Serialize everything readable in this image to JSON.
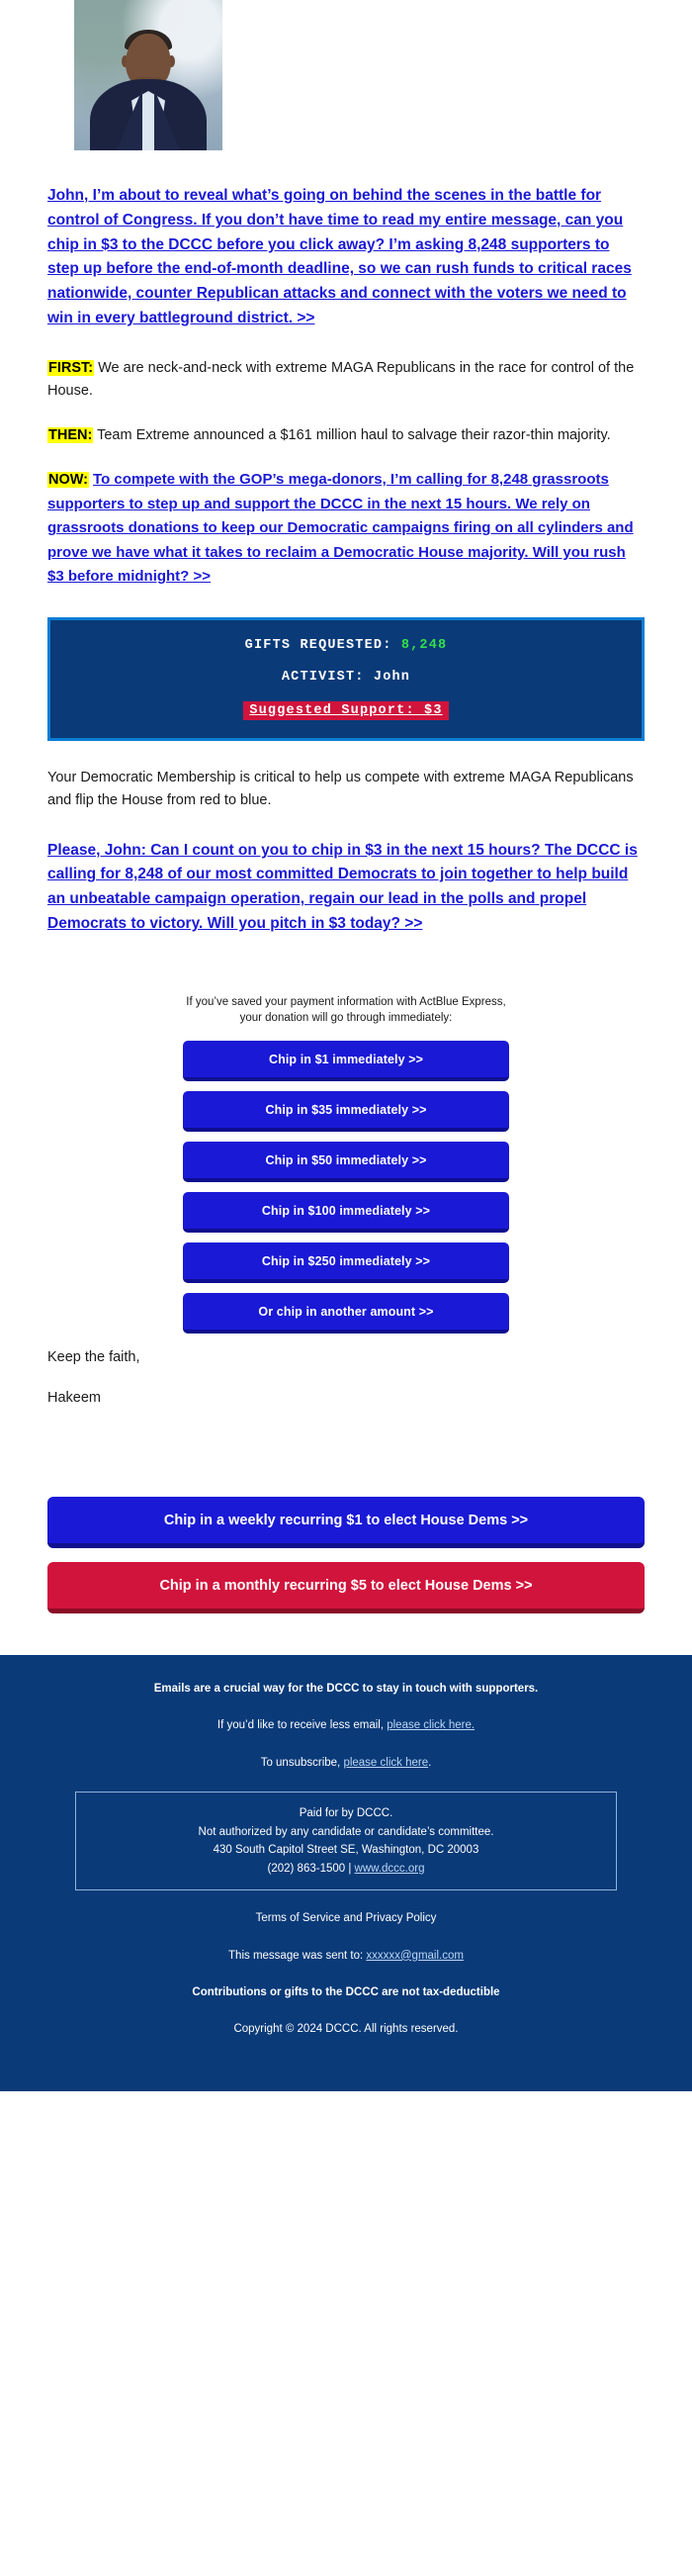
{
  "hero": {
    "photo_alt": "hakeem-jeffries-portrait"
  },
  "lead": {
    "text": "John, I’m about to reveal what’s going on behind the scenes in the battle for control of Congress. If you don’t have time to read my entire message, can you chip in $3 to the DCCC before you click away? I’m asking 8,248 supporters to step up before the end-of-month deadline, so we can rush funds to critical races nationwide, counter Republican attacks and connect with the voters we need to win in every battleground district. >>"
  },
  "sections": {
    "first_label": "FIRST:",
    "first_text": " We are neck-and-neck with extreme MAGA Republicans in the race for control of the House.",
    "then_label": "THEN:",
    "then_text": " Team Extreme announced a $161 million haul to salvage their razor-thin majority.",
    "now_label": "NOW:",
    "now_link": "To compete with the GOP’s mega-donors, I’m calling for 8,248 grassroots supporters to step up and support the DCCC in the next 15 hours. We rely on grassroots donations to keep our Democratic campaigns firing on all cylinders and prove we have what it takes to reclaim a Democratic House majority. Will you rush $3 before midnight? >>"
  },
  "terminal": {
    "gifts_label": "GIFTS REQUESTED:",
    "gifts_value": "8,248",
    "activist_label": "ACTIVIST:",
    "activist_value": "John",
    "suggested": "Suggested Support: $3",
    "border_color": "#0b7dd4",
    "bg_color": "#0a3a78",
    "value_color": "#33e04a",
    "suggested_bg": "#d1143c"
  },
  "membership": {
    "text": "Your Democratic Membership is critical to help us compete with extreme MAGA Republicans and flip the House from red to blue."
  },
  "ask": {
    "text": "Please, John: Can I count on you to chip in $3 in the next 15 hours? The DCCC is calling for 8,248 of our most committed Democrats to join together to help build an unbeatable campaign operation, regain our lead in the polls and propel Democrats to victory. Will you pitch in $3 today? >>"
  },
  "donate": {
    "express_note_line1": "If you’ve saved your payment information with ActBlue Express,",
    "express_note_line2": "your donation will go through immediately:",
    "buttons": [
      {
        "label": "Chip in $1 immediately >>"
      },
      {
        "label": "Chip in $35 immediately >>"
      },
      {
        "label": "Chip in $50 immediately >>"
      },
      {
        "label": "Chip in $100 immediately >>"
      },
      {
        "label": "Chip in $250 immediately >>"
      },
      {
        "label": "Or chip in another amount >>"
      }
    ]
  },
  "signoff": {
    "line1": "Keep the faith,",
    "line2": "Hakeem"
  },
  "recurring": {
    "weekly": "Chip in a weekly recurring $1 to elect House Dems >>",
    "monthly": "Chip in a monthly recurring $5 to elect House Dems >>"
  },
  "footer": {
    "line1": "Emails are a crucial way for the DCCC to stay in touch with supporters.",
    "line2_prefix": "If you’d like to receive less email, ",
    "line2_link": "please click here.",
    "line3_prefix": "To unsubscribe, ",
    "line3_link": "please click here",
    "line3_suffix": ".",
    "paid_line1": "Paid for by DCCC.",
    "paid_line2": "Not authorized by any candidate or candidate’s committee.",
    "paid_line3": "430 South Capitol Street SE, Washington, DC 20003",
    "paid_line4_prefix": "(202) 863-1500 | ",
    "paid_line4_link": "www.dccc.org",
    "terms": "Terms of Service and Privacy Policy",
    "sent_to_prefix": "This message was sent to: ",
    "sent_to_email": "xxxxxx@gmail.com",
    "tax": "Contributions or gifts to the DCCC are not tax-deductible",
    "copyright": "Copyright © 2024 DCCC. All rights reserved."
  }
}
